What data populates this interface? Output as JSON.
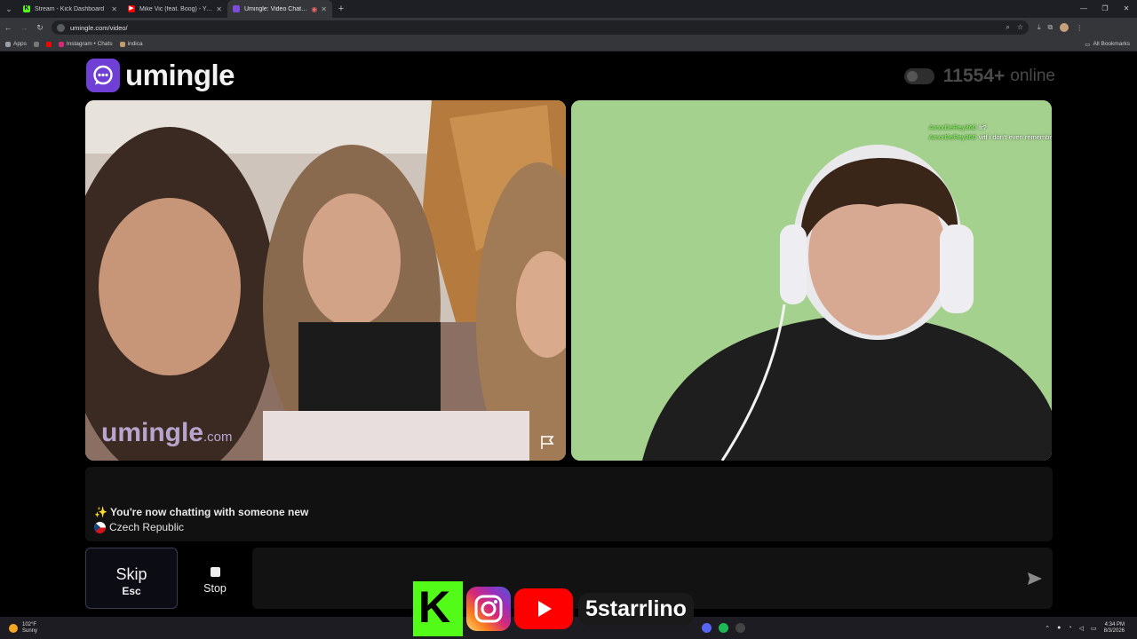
{
  "browser": {
    "tabs": [
      {
        "title": "Stream - Kick Dashboard",
        "favicon_color": "#53fc18",
        "active": false
      },
      {
        "title": "Mike Vic (feat. Boog) - YouTube",
        "favicon_color": "#ff0000",
        "active": false
      },
      {
        "title": "Umingle: Video Chat with S",
        "favicon_color": "#7a4ddb",
        "active": true
      }
    ],
    "url": "umingle.com/video/",
    "bookmarks": [
      {
        "label": "Apps",
        "color": "#9aa0a6"
      },
      {
        "label": "Instagram • Chats",
        "color": "#d62976"
      },
      {
        "label": "indica",
        "color": "#c49a6c"
      }
    ],
    "all_bookmarks": "All Bookmarks"
  },
  "header": {
    "logo_text": "umingle",
    "online_count": "11554+",
    "online_label": "online"
  },
  "stranger_video": {
    "watermark": "umingle",
    "watermark_suffix": ".com"
  },
  "self_video": {
    "chat": [
      {
        "nick": "AmorDeRey360",
        "text": "fr?"
      },
      {
        "nick": "AmorDeRey360",
        "text": "wtf i don't even remember"
      }
    ]
  },
  "status": {
    "message": "✨ You're now chatting with someone new",
    "country": "Czech Republic"
  },
  "controls": {
    "skip_label": "Skip",
    "skip_key": "Esc",
    "stop_label": "Stop",
    "message_placeholder": ""
  },
  "overlay": {
    "handle": "5starrlino"
  },
  "taskbar": {
    "temperature": "102°F",
    "condition": "Sunny",
    "time": "4:34 PM",
    "date": "8/3/2026"
  },
  "colors": {
    "brand_purple": "#6f3fd6",
    "chat_nick_green": "#7cff4d"
  }
}
